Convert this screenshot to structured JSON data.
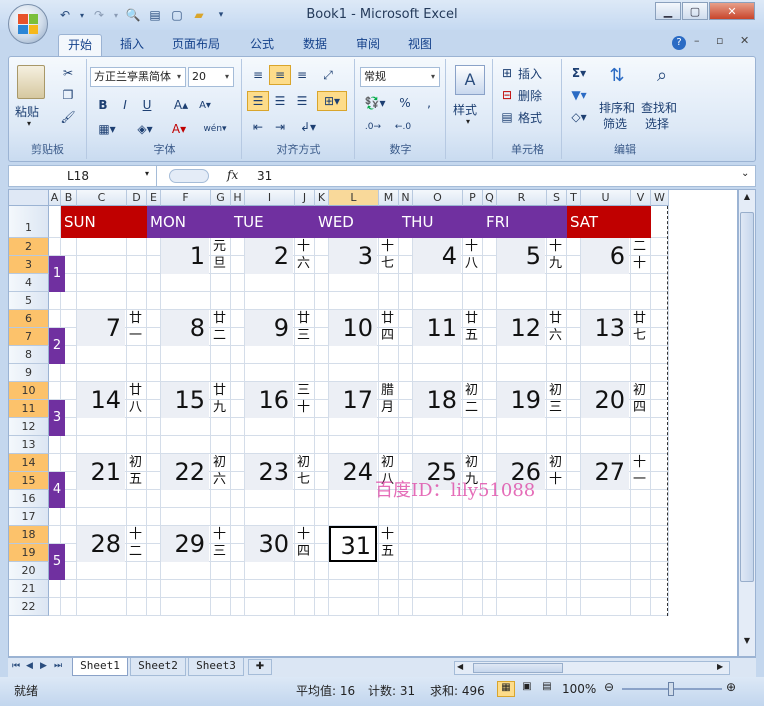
{
  "window": {
    "title": "Book1 - Microsoft Excel"
  },
  "ribbon_tabs": [
    "开始",
    "插入",
    "页面布局",
    "公式",
    "数据",
    "审阅",
    "视图"
  ],
  "clipboard": {
    "paste": "粘贴",
    "label": "剪贴板"
  },
  "font": {
    "name": "方正兰亭黑简体",
    "size": "20",
    "label": "字体"
  },
  "alignment": {
    "label": "对齐方式"
  },
  "number": {
    "format": "常规",
    "label": "数字"
  },
  "styles": {
    "label": "样式"
  },
  "cells": {
    "insert": "插入",
    "delete": "删除",
    "format": "格式",
    "label": "单元格"
  },
  "editing": {
    "sort": "排序和",
    "sort2": "筛选",
    "find": "查找和",
    "find2": "选择",
    "label": "编辑"
  },
  "formula_bar": {
    "name_box": "L18",
    "fx": "fx",
    "content": "31"
  },
  "columns": [
    "A",
    "B",
    "C",
    "D",
    "E",
    "F",
    "G",
    "H",
    "I",
    "J",
    "K",
    "L",
    "M",
    "N",
    "O",
    "P",
    "Q",
    "R",
    "S",
    "T",
    "U",
    "V",
    "W"
  ],
  "rows": [
    "1",
    "2",
    "3",
    "4",
    "5",
    "6",
    "7",
    "8",
    "9",
    "10",
    "11",
    "12",
    "13",
    "14",
    "15",
    "16",
    "17",
    "18",
    "19",
    "20",
    "21",
    "22"
  ],
  "calendar": {
    "days": [
      "SUN",
      "MON",
      "TUE",
      "WED",
      "THU",
      "FRI",
      "SAT"
    ],
    "weeks": [
      "1",
      "2",
      "3",
      "4",
      "5"
    ],
    "dates": [
      [
        {
          "d": "",
          "l1": "",
          "l2": ""
        },
        {
          "d": "1",
          "l1": "元",
          "l2": "旦"
        },
        {
          "d": "2",
          "l1": "十",
          "l2": "六"
        },
        {
          "d": "3",
          "l1": "十",
          "l2": "七"
        },
        {
          "d": "4",
          "l1": "十",
          "l2": "八"
        },
        {
          "d": "5",
          "l1": "十",
          "l2": "九"
        },
        {
          "d": "6",
          "l1": "二",
          "l2": "十"
        }
      ],
      [
        {
          "d": "7",
          "l1": "廿",
          "l2": "一"
        },
        {
          "d": "8",
          "l1": "廿",
          "l2": "二"
        },
        {
          "d": "9",
          "l1": "廿",
          "l2": "三"
        },
        {
          "d": "10",
          "l1": "廿",
          "l2": "四"
        },
        {
          "d": "11",
          "l1": "廿",
          "l2": "五"
        },
        {
          "d": "12",
          "l1": "廿",
          "l2": "六"
        },
        {
          "d": "13",
          "l1": "廿",
          "l2": "七"
        }
      ],
      [
        {
          "d": "14",
          "l1": "廿",
          "l2": "八"
        },
        {
          "d": "15",
          "l1": "廿",
          "l2": "九"
        },
        {
          "d": "16",
          "l1": "三",
          "l2": "十"
        },
        {
          "d": "17",
          "l1": "腊",
          "l2": "月"
        },
        {
          "d": "18",
          "l1": "初",
          "l2": "二"
        },
        {
          "d": "19",
          "l1": "初",
          "l2": "三"
        },
        {
          "d": "20",
          "l1": "初",
          "l2": "四"
        }
      ],
      [
        {
          "d": "21",
          "l1": "初",
          "l2": "五"
        },
        {
          "d": "22",
          "l1": "初",
          "l2": "六"
        },
        {
          "d": "23",
          "l1": "初",
          "l2": "七"
        },
        {
          "d": "24",
          "l1": "初",
          "l2": "八"
        },
        {
          "d": "25",
          "l1": "初",
          "l2": "九"
        },
        {
          "d": "26",
          "l1": "初",
          "l2": "十"
        },
        {
          "d": "27",
          "l1": "十",
          "l2": "一"
        }
      ],
      [
        {
          "d": "28",
          "l1": "十",
          "l2": "二"
        },
        {
          "d": "29",
          "l1": "十",
          "l2": "三"
        },
        {
          "d": "30",
          "l1": "十",
          "l2": "四"
        },
        {
          "d": "31",
          "l1": "十",
          "l2": "五"
        }
      ]
    ]
  },
  "watermark": "百度ID：lily51088",
  "sheet_tabs": [
    "Sheet1",
    "Sheet2",
    "Sheet3"
  ],
  "status": {
    "ready": "就绪",
    "average": "平均值: 16",
    "count": "计数: 31",
    "sum": "求和: 496",
    "zoom": "100%"
  },
  "colors": {
    "sun_sat": "#c00000",
    "weekday": "#7030a0",
    "date_bg": "#eceff5",
    "row_orange": "#fcc26b"
  }
}
